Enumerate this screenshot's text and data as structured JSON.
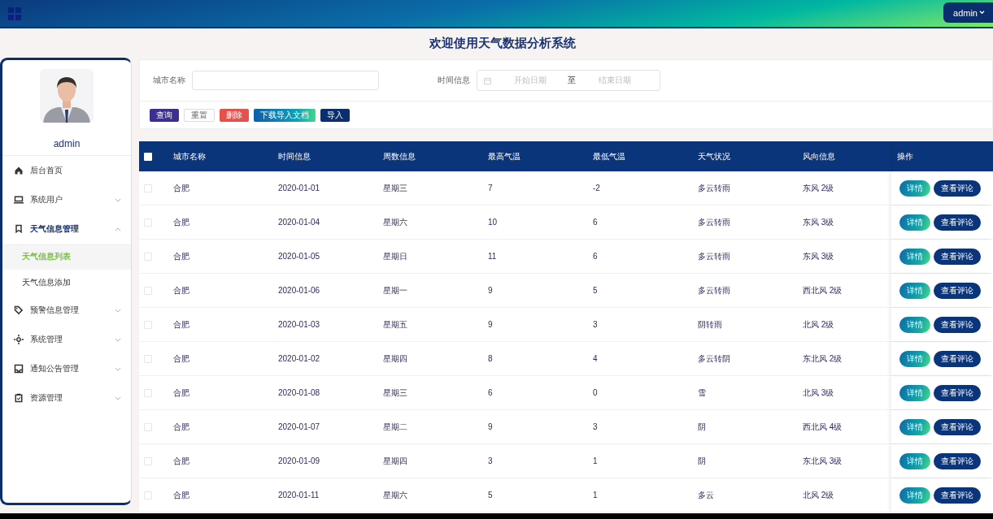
{
  "header": {
    "user_menu": "admin"
  },
  "title": "欢迎使用天气数据分析系统",
  "sidebar": {
    "username": "admin",
    "menu": [
      {
        "label": "后台首页"
      },
      {
        "label": "系统用户",
        "expanded": false
      },
      {
        "label": "天气信息管理",
        "expanded": true,
        "children": [
          {
            "label": "天气信息列表",
            "selected": true
          },
          {
            "label": "天气信息添加",
            "selected": false
          }
        ]
      },
      {
        "label": "预警信息管理",
        "expanded": false
      },
      {
        "label": "系统管理",
        "expanded": false
      },
      {
        "label": "通知公告管理",
        "expanded": false
      },
      {
        "label": "资源管理",
        "expanded": false
      }
    ]
  },
  "search": {
    "city_label": "城市名称",
    "time_label": "时间信息",
    "start_placeholder": "开始日期",
    "separator": "至",
    "end_placeholder": "结束日期",
    "buttons": [
      {
        "label": "查询",
        "kind": "query"
      },
      {
        "label": "重置",
        "kind": "reset"
      },
      {
        "label": "删除",
        "kind": "delete"
      },
      {
        "label": "下载导入文档",
        "kind": "download"
      },
      {
        "label": "导入",
        "kind": "import"
      }
    ]
  },
  "table": {
    "header_checked": false,
    "columns": [
      "城市名称",
      "时间信息",
      "周数信息",
      "最高气温",
      "最低气温",
      "天气状况",
      "风向信息",
      "操作"
    ],
    "rows": [
      {
        "checked": false,
        "cells": [
          "合肥",
          "2020-01-01",
          "星期三",
          "7",
          "-2",
          "多云转雨",
          "东风 2级"
        ],
        "actions": [
          "详情",
          "查看评论"
        ]
      },
      {
        "checked": false,
        "cells": [
          "合肥",
          "2020-01-04",
          "星期六",
          "10",
          "6",
          "多云转雨",
          "东风 3级"
        ],
        "actions": [
          "详情",
          "查看评论"
        ]
      },
      {
        "checked": false,
        "cells": [
          "合肥",
          "2020-01-05",
          "星期日",
          "11",
          "6",
          "多云转雨",
          "东风 3级"
        ],
        "actions": [
          "详情",
          "查看评论"
        ]
      },
      {
        "checked": false,
        "cells": [
          "合肥",
          "2020-01-06",
          "星期一",
          "9",
          "5",
          "多云转雨",
          "西北风 2级"
        ],
        "actions": [
          "详情",
          "查看评论"
        ]
      },
      {
        "checked": false,
        "cells": [
          "合肥",
          "2020-01-03",
          "星期五",
          "9",
          "3",
          "阴转雨",
          "北风 2级"
        ],
        "actions": [
          "详情",
          "查看评论"
        ]
      },
      {
        "checked": false,
        "cells": [
          "合肥",
          "2020-01-02",
          "星期四",
          "8",
          "4",
          "多云转阴",
          "东北风 2级"
        ],
        "actions": [
          "详情",
          "查看评论"
        ]
      },
      {
        "checked": false,
        "cells": [
          "合肥",
          "2020-01-08",
          "星期三",
          "6",
          "0",
          "雪",
          "北风 3级"
        ],
        "actions": [
          "详情",
          "查看评论"
        ]
      },
      {
        "checked": false,
        "cells": [
          "合肥",
          "2020-01-07",
          "星期二",
          "9",
          "3",
          "阴",
          "西北风 4级"
        ],
        "actions": [
          "详情",
          "查看评论"
        ]
      },
      {
        "checked": false,
        "cells": [
          "合肥",
          "2020-01-09",
          "星期四",
          "3",
          "1",
          "阴",
          "东北风 3级"
        ],
        "actions": [
          "详情",
          "查看评论"
        ]
      },
      {
        "checked": false,
        "cells": [
          "合肥",
          "2020-01-11",
          "星期六",
          "5",
          "1",
          "多云",
          "北风 2级"
        ],
        "actions": [
          "详情",
          "查看评论"
        ]
      }
    ]
  }
}
